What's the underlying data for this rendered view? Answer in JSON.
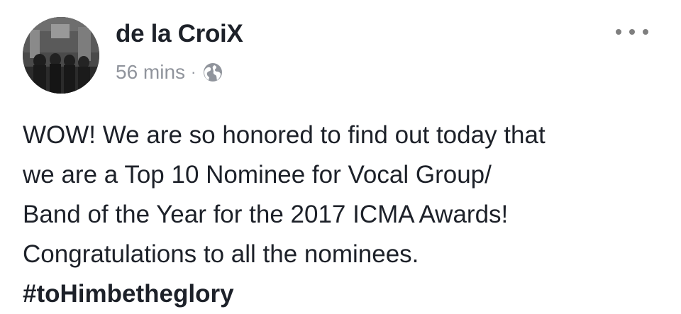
{
  "post": {
    "author": "de la CroiX",
    "timestamp": "56 mins",
    "separator": "·",
    "privacy_icon": "globe-icon",
    "more_icon": "more-options-icon",
    "lines": [
      "WOW! We are so honored to find out today that",
      "we are a Top 10 Nominee for Vocal Group/",
      "Band of the Year for the 2017 ICMA Awards!",
      "Congratulations to all the nominees."
    ],
    "hashtag": "#toHimbetheglory"
  },
  "colors": {
    "text": "#1d2129",
    "meta": "#90949c",
    "more_dots": "#7f7f7f"
  }
}
